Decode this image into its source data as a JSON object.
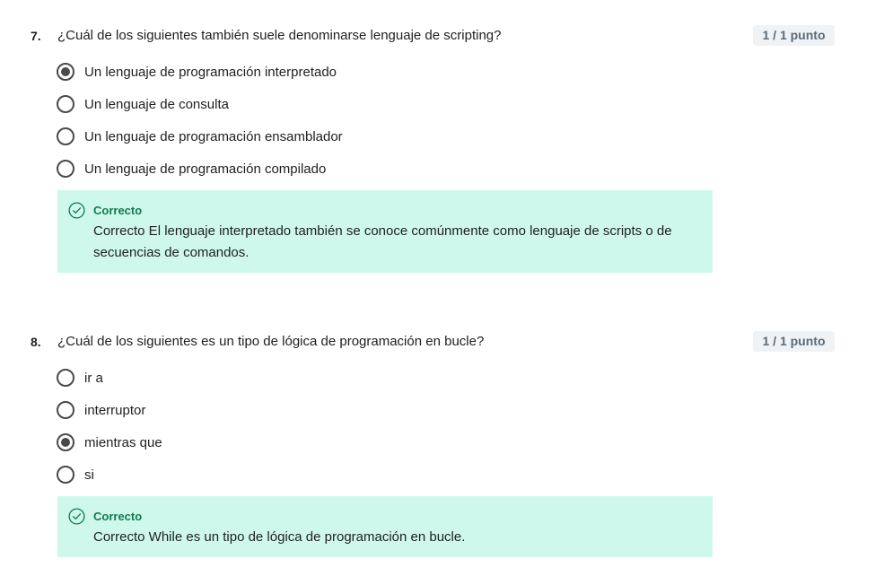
{
  "questions": [
    {
      "number": "7.",
      "text": "¿Cuál de los siguientes también suele denominarse lenguaje de scripting?",
      "score": "1 / 1 punto",
      "options": [
        {
          "label": "Un lenguaje de programación interpretado",
          "selected": true
        },
        {
          "label": "Un lenguaje de consulta",
          "selected": false
        },
        {
          "label": "Un lenguaje de programación ensamblador",
          "selected": false
        },
        {
          "label": "Un lenguaje de programación compilado",
          "selected": false
        }
      ],
      "feedback": {
        "icon": "check-circle-icon",
        "title": "Correcto",
        "text": "Correcto El lenguaje interpretado también se conoce comúnmente como lenguaje de scripts o de secuencias de comandos."
      }
    },
    {
      "number": "8.",
      "text": "¿Cuál de los siguientes es un tipo de lógica de programación en bucle?",
      "score": "1 / 1 punto",
      "options": [
        {
          "label": "ir a",
          "selected": false
        },
        {
          "label": "interruptor",
          "selected": false
        },
        {
          "label": "mientras que",
          "selected": true
        },
        {
          "label": "si",
          "selected": false
        }
      ],
      "feedback": {
        "icon": "check-circle-icon",
        "title": "Correcto",
        "text": "Correcto While es un tipo de lógica de programación en bucle."
      }
    }
  ],
  "colors": {
    "feedback_background": "#cff8ec",
    "feedback_title": "#137a4f",
    "score_badge_background": "#f0f3f6"
  }
}
